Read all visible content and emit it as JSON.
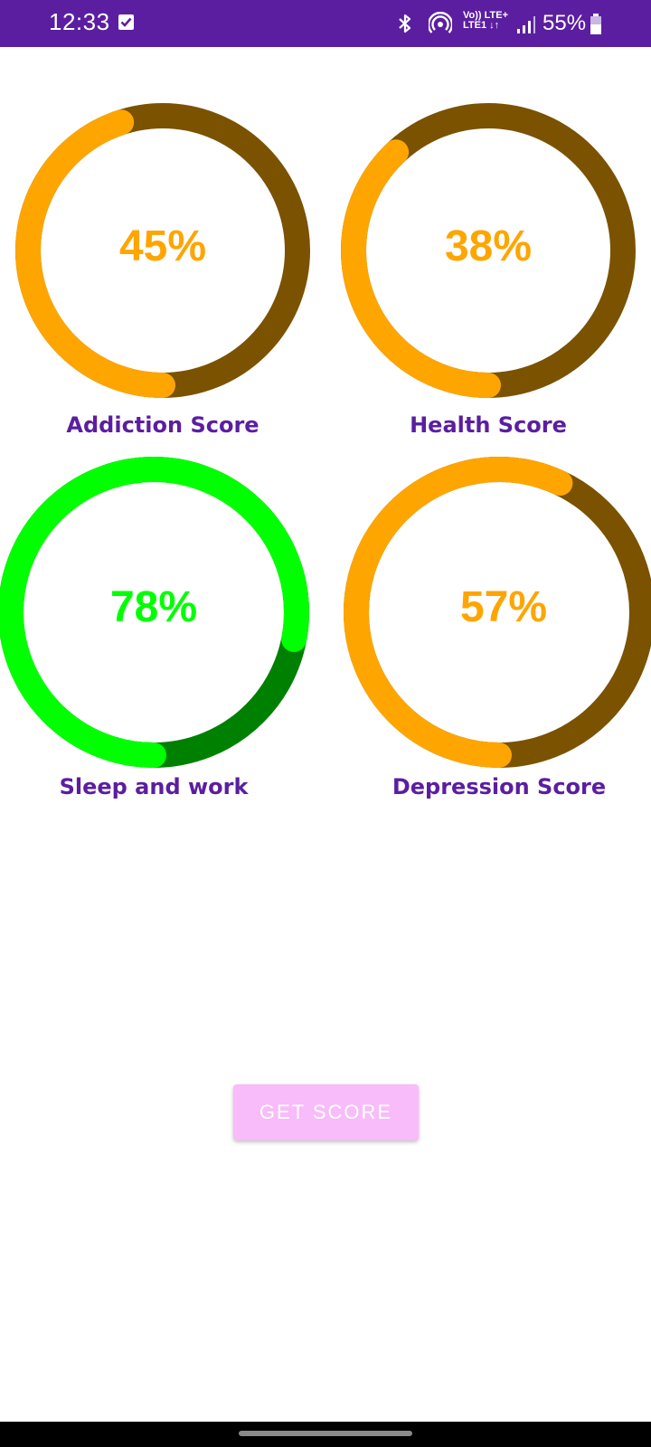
{
  "status_bar": {
    "time": "12:33",
    "network_top": "Vo)) LTE+",
    "network_bottom": "LTE1 ↓↑",
    "battery": "55%",
    "icons": [
      "checkbox-notification-icon",
      "bluetooth-icon",
      "hotspot-icon",
      "volte-icon",
      "signal-icon",
      "battery-icon"
    ]
  },
  "gauges": [
    {
      "value_text": "45%",
      "percent": 45,
      "label": "Addiction Score",
      "fill_color": "#ffa500",
      "track_color": "#7a5200",
      "text_color": "#ffa500"
    },
    {
      "value_text": "38%",
      "percent": 38,
      "label": "Health Score",
      "fill_color": "#ffa500",
      "track_color": "#7a5200",
      "text_color": "#ffa500"
    },
    {
      "value_text": "78%",
      "percent": 78,
      "label": "Sleep and work",
      "fill_color": "#00ff00",
      "track_color": "#008000",
      "text_color": "#00ff00"
    },
    {
      "value_text": "57%",
      "percent": 57,
      "label": "Depression Score",
      "fill_color": "#ffa500",
      "track_color": "#7a5200",
      "text_color": "#ffa500"
    }
  ],
  "get_score_button": {
    "label": "GET SCORE",
    "color": "#f7bcf9"
  },
  "colors": {
    "status_bar": "#5b1ea0",
    "label_text": "#5b1ea0"
  }
}
